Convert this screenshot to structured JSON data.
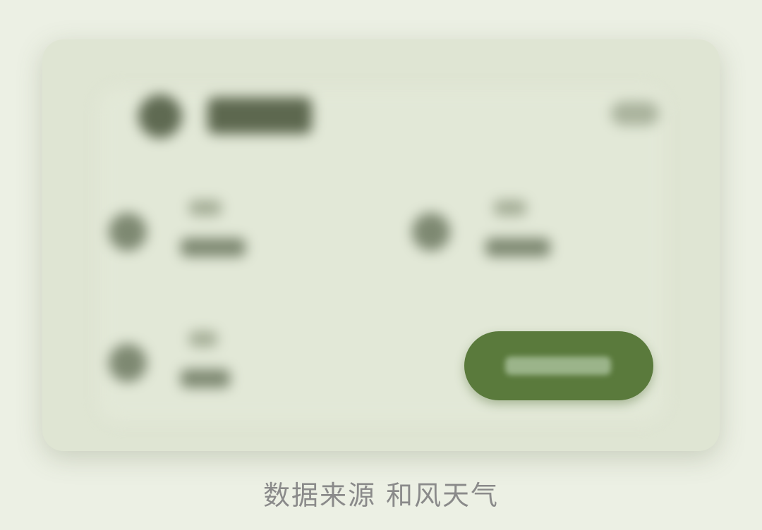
{
  "widget": {
    "accent_color": "#5a7a3c",
    "card_color": "#dfe5d3",
    "header_icon": "weather-icon",
    "stats": [
      {
        "icon": "wind-icon"
      },
      {
        "icon": "humidity-icon"
      },
      {
        "icon": "pressure-icon"
      }
    ],
    "more_icon": "more-icon"
  },
  "footer": {
    "caption": "数据来源 和风天气"
  }
}
